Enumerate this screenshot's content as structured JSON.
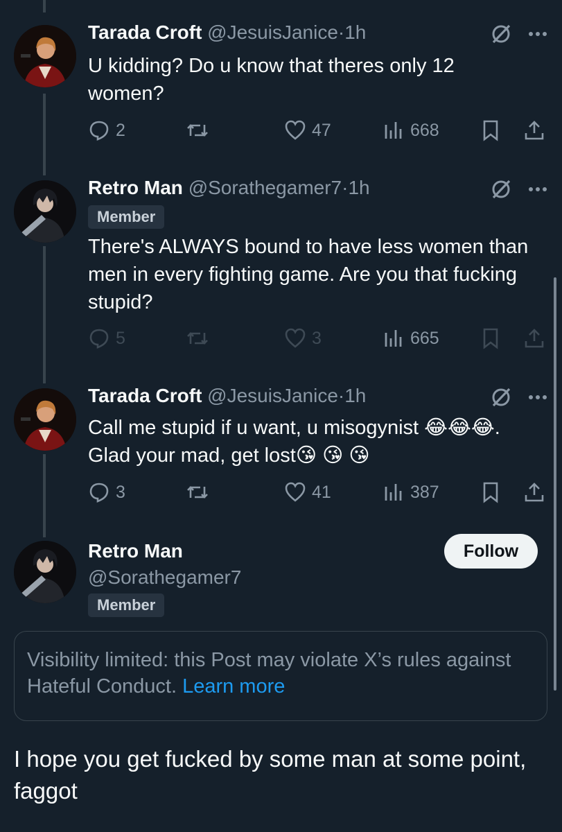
{
  "tweets": [
    {
      "name": "Tarada Croft",
      "handle": "@JesuisJanice",
      "time": "1h",
      "text": "U kidding? Do u know that theres only 12 women?",
      "replies": "2",
      "likes": "47",
      "views": "668"
    },
    {
      "name": "Retro Man",
      "handle": "@Sorathegamer7",
      "time": "1h",
      "badge": "Member",
      "text": "There's ALWAYS bound to have less women than men in every fighting game. Are you that fucking stupid?",
      "replies": "5",
      "likes": "3",
      "views": "665"
    },
    {
      "name": "Tarada Croft",
      "handle": "@JesuisJanice",
      "time": "1h",
      "text": "Call me stupid if u want, u misogynist 😂😂😂. Glad your mad, get lost😘 😘 😘",
      "replies": "3",
      "likes": "41",
      "views": "387"
    }
  ],
  "main_post": {
    "name": "Retro Man",
    "handle": "@Sorathegamer7",
    "badge": "Member",
    "follow_label": "Follow",
    "notice_text": "Visibility limited: this Post may violate X’s rules against Hateful Conduct.",
    "notice_link": "Learn more",
    "text": "I hope you get fucked by some man at some point, faggot"
  },
  "separator": "·",
  "icons": [
    "grok-icon",
    "more-icon",
    "reply-icon",
    "repost-icon",
    "like-icon",
    "views-icon",
    "bookmark-icon",
    "share-icon"
  ],
  "colors": {
    "background": "#15202b",
    "text": "#f7f9f9",
    "muted": "#8b98a5",
    "link": "#1d9bf0",
    "follow_bg": "#eff3f4"
  }
}
